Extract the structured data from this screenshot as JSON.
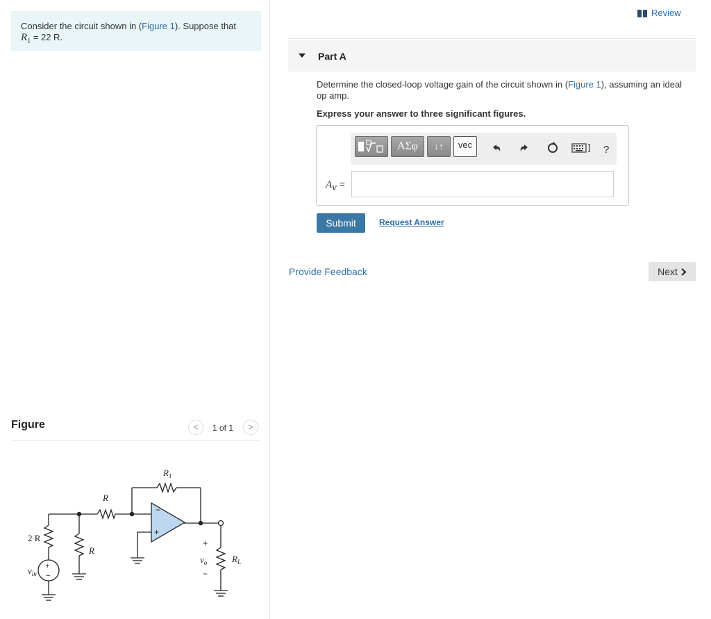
{
  "problem": {
    "text_before": "Consider the circuit shown in (",
    "figure_link": "Figure 1",
    "text_after": "). Suppose that",
    "r1_symbol": "R",
    "r1_subscript": "1",
    "r1_value": " = 22 R."
  },
  "figure": {
    "title": "Figure",
    "pager_prev": "<",
    "pager_text": "1 of 1",
    "pager_next": ">",
    "circuit": {
      "label_r1": "R",
      "label_r1_sub": "1",
      "label_r_top": "R",
      "label_2r": "2 R",
      "label_r_shunt": "R",
      "label_vin": "v",
      "label_vin_sub": "in",
      "label_vo": "v",
      "label_vo_sub": "o",
      "label_rl": "R",
      "label_rl_sub": "L",
      "plus": "+",
      "minus": "−"
    }
  },
  "review": {
    "label": "Review"
  },
  "part": {
    "title": "Part A",
    "question_before": "Determine the closed-loop voltage gain of the circuit shown in (",
    "question_link": "Figure 1",
    "question_after": "), assuming an ideal op amp.",
    "instruction": "Express your answer to three significant figures."
  },
  "toolbar": {
    "greek_label": "ΑΣφ",
    "arrows_label": "↓↑",
    "vec_label": "vec",
    "help_label": "?"
  },
  "answer": {
    "label_symbol": "A",
    "label_sub": "v",
    "label_eq": " =",
    "value": ""
  },
  "actions": {
    "submit": "Submit",
    "request": "Request Answer",
    "feedback": "Provide Feedback",
    "next": "Next"
  }
}
